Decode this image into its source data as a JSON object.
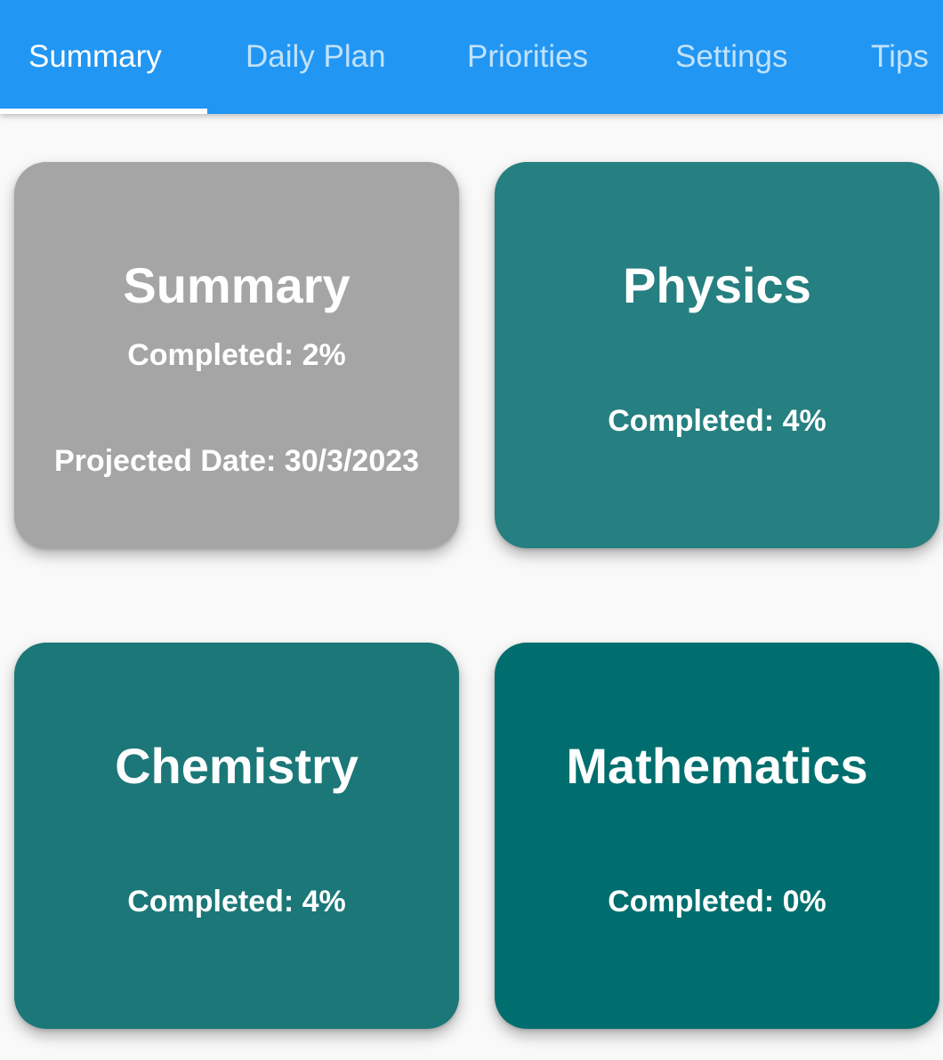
{
  "tabs": [
    {
      "label": "Summary",
      "active": true
    },
    {
      "label": "Daily Plan",
      "active": false
    },
    {
      "label": "Priorities",
      "active": false
    },
    {
      "label": "Settings",
      "active": false
    },
    {
      "label": "Tips",
      "active": false
    }
  ],
  "colors": {
    "tab_bar": "#2196f3",
    "background": "#faf9f9",
    "summary_card": "#a5a5a5",
    "physics_card": "#267f80",
    "chemistry_card": "#1b7778",
    "mathematics_card": "#006e6e"
  },
  "cards": {
    "summary": {
      "title": "Summary",
      "completed": "Completed: 2%",
      "projected": "Projected Date: 30/3/2023"
    },
    "physics": {
      "title": "Physics",
      "completed": "Completed: 4%"
    },
    "chemistry": {
      "title": "Chemistry",
      "completed": "Completed: 4%"
    },
    "mathematics": {
      "title": "Mathematics",
      "completed": "Completed: 0%"
    }
  }
}
